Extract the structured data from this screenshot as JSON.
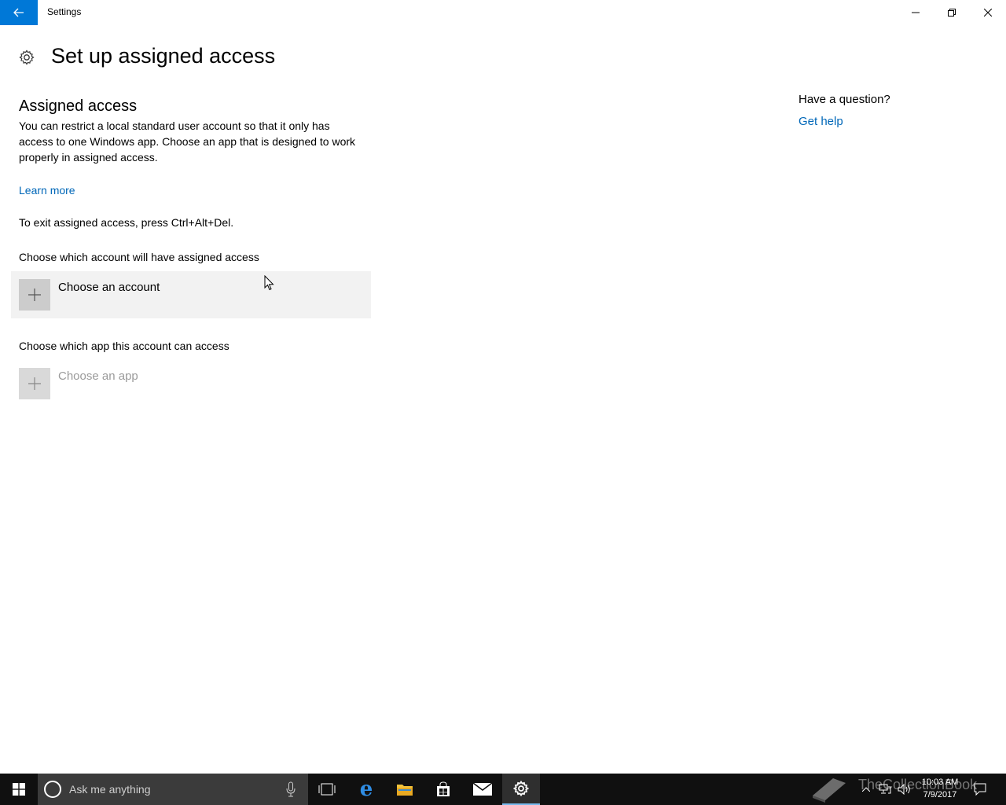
{
  "window": {
    "app_title": "Settings",
    "back_icon": "back-arrow-icon",
    "controls": [
      "minimize-icon",
      "restore-icon",
      "close-icon"
    ]
  },
  "header": {
    "icon": "gear-icon",
    "title": "Set up assigned access"
  },
  "main": {
    "section_title": "Assigned access",
    "description": "You can restrict a local standard user account so that it only has access to one Windows app. Choose an app that is designed to work properly in assigned access.",
    "learn_more": "Learn more",
    "exit_note": "To exit assigned access, press Ctrl+Alt+Del.",
    "account_label": "Choose which account will have assigned access",
    "account_button": "Choose an account",
    "app_label": "Choose which app this account can access",
    "app_button": "Choose an app"
  },
  "help": {
    "question": "Have a question?",
    "link": "Get help"
  },
  "taskbar": {
    "search_placeholder": "Ask me anything",
    "time": "10:03 AM",
    "date": "7/9/2017",
    "watermark": "TheCollectionBook",
    "accent": "#76b9ed"
  },
  "colors": {
    "accent": "#0078d7",
    "link": "#0067b8"
  }
}
